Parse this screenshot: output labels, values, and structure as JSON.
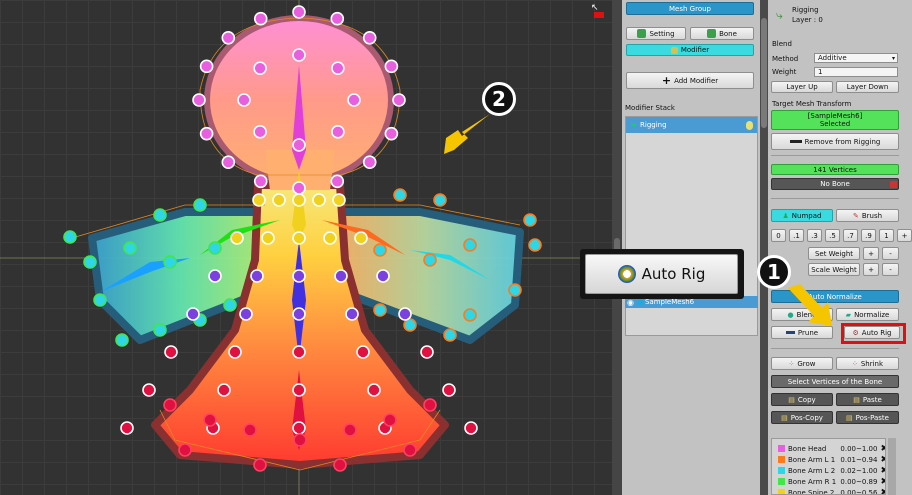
{
  "header": {
    "mesh_group_tab": "Mesh Group",
    "setting_btn": "Setting",
    "bone_btn": "Bone",
    "modifier_btn": "Modifier",
    "add_modifier_btn": "Add Modifier"
  },
  "modifier_stack": {
    "title": "Modifier Stack",
    "items": [
      {
        "label": "Rigging"
      }
    ],
    "mesh_item": "SampleMesh6"
  },
  "props": {
    "name": "Rigging",
    "layer": "Layer : 0",
    "blend_title": "Blend",
    "method_label": "Method",
    "method_value": "Additive",
    "weight_label": "Weight",
    "weight_value": "1",
    "layer_up": "Layer Up",
    "layer_down": "Layer Down",
    "target_title": "Target Mesh Transform",
    "target_name": "[SampleMesh6]",
    "target_state": "Selected",
    "remove_btn": "Remove from Rigging",
    "vertices": "141 Vertices",
    "no_bone": "No Bone",
    "numpad": "Numpad",
    "brush": "Brush",
    "num_keys": [
      "0",
      ".1",
      ".3",
      ".5",
      ".7",
      ".9",
      "1"
    ],
    "plus": "+",
    "minus": "-",
    "set_weight": "Set Weight",
    "scale_weight": "Scale Weight",
    "auto_normalize": "Auto Normalize",
    "blend": "Blend",
    "normalize": "Normalize",
    "prune": "Prune",
    "auto_rig": "Auto Rig",
    "grow": "Grow",
    "shrink": "Shrink",
    "select_vertices": "Select Vertices of the Bone",
    "copy": "Copy",
    "paste": "Paste",
    "pos_copy": "Pos-Copy",
    "pos_paste": "Pos-Paste"
  },
  "bones": [
    {
      "name": "Bone Head",
      "range": "0.00~1.00",
      "color": "#e85fe0"
    },
    {
      "name": "Bone Arm L 1",
      "range": "0.01~0.94",
      "color": "#ff7a1a"
    },
    {
      "name": "Bone Arm L 2",
      "range": "0.02~1.00",
      "color": "#2fd7e6"
    },
    {
      "name": "Bone Arm R 1",
      "range": "0.00~0.89",
      "color": "#42e64a"
    },
    {
      "name": "Bone Spine 2",
      "range": "0.00~0.56",
      "color": "#f0d21e"
    }
  ],
  "callout": {
    "label": "Auto Rig",
    "step1": "1",
    "step2": "2"
  },
  "colors": {
    "accent_red": "#e01010",
    "panel_bg": "#c2c2c2",
    "selection_blue": "#4a9bd3",
    "cyan": "#39dbe0",
    "green": "#55e25b",
    "arrow": "#f5c500"
  }
}
